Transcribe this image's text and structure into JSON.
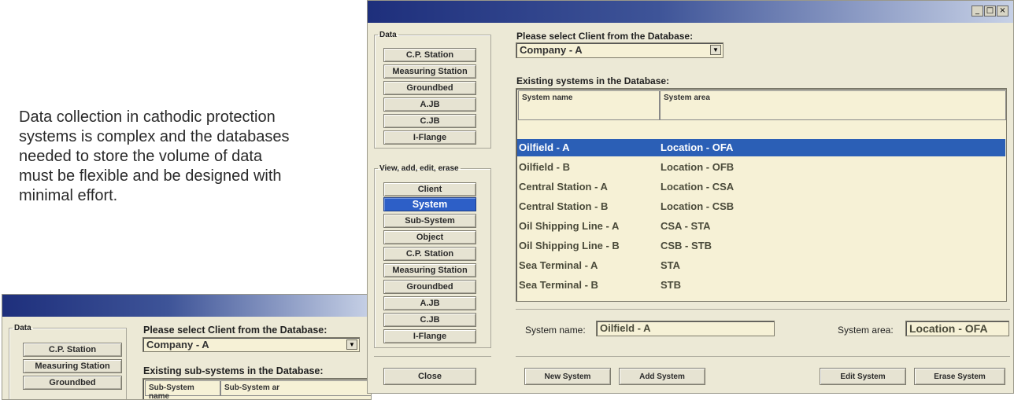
{
  "caption": {
    "line1": "Data collection in cathodic protection",
    "line2": "systems is complex and the databases",
    "line3": "needed to store the volume of data",
    "line4": "must be flexible and be designed with",
    "line5": "minimal effort."
  },
  "main_window": {
    "controls": {
      "minimize": "_",
      "maximize": "□",
      "close": "×"
    },
    "data_group": {
      "legend": "Data",
      "buttons": [
        "C.P. Station",
        "Measuring Station",
        "Groundbed",
        "A.JB",
        "C.JB",
        "I-Flange"
      ]
    },
    "view_group": {
      "legend": "View, add, edit, erase",
      "buttons": [
        "Client",
        "System",
        "Sub-System",
        "Object",
        "C.P. Station",
        "Measuring Station",
        "Groundbed",
        "A.JB",
        "C.JB",
        "I-Flange"
      ],
      "active": "System"
    },
    "close_label": "Close",
    "client_label": "Please select Client from the Database:",
    "client_value": "Company - A",
    "systems_label": "Existing systems in the Database:",
    "columns": [
      "System name",
      "System area"
    ],
    "rows": [
      {
        "name": "Oilfield - A",
        "area": "Location - OFA",
        "selected": true
      },
      {
        "name": "Oilfield - B",
        "area": "Location - OFB"
      },
      {
        "name": "Central Station - A",
        "area": "Location - CSA"
      },
      {
        "name": "Central Station - B",
        "area": "Location - CSB"
      },
      {
        "name": "Oil Shipping Line - A",
        "area": "CSA - STA"
      },
      {
        "name": "Oil Shipping Line - B",
        "area": "CSB - STB"
      },
      {
        "name": "Sea Terminal - A",
        "area": "STA"
      },
      {
        "name": "Sea Terminal - B",
        "area": "STB"
      }
    ],
    "system_name_label": "System name:",
    "system_name_value": "Oilfield - A",
    "system_area_label": "System area:",
    "system_area_value": "Location - OFA",
    "actions": [
      "New System",
      "Add System",
      "Edit System",
      "Erase System"
    ]
  },
  "back_window": {
    "data_group": {
      "legend": "Data",
      "buttons": [
        "C.P. Station",
        "Measuring Station",
        "Groundbed"
      ]
    },
    "client_label": "Please select Client from the Database:",
    "client_value": "Company - A",
    "subsystems_label": "Existing sub-systems in the Database:",
    "columns": [
      "Sub-System name",
      "Sub-System ar"
    ]
  }
}
